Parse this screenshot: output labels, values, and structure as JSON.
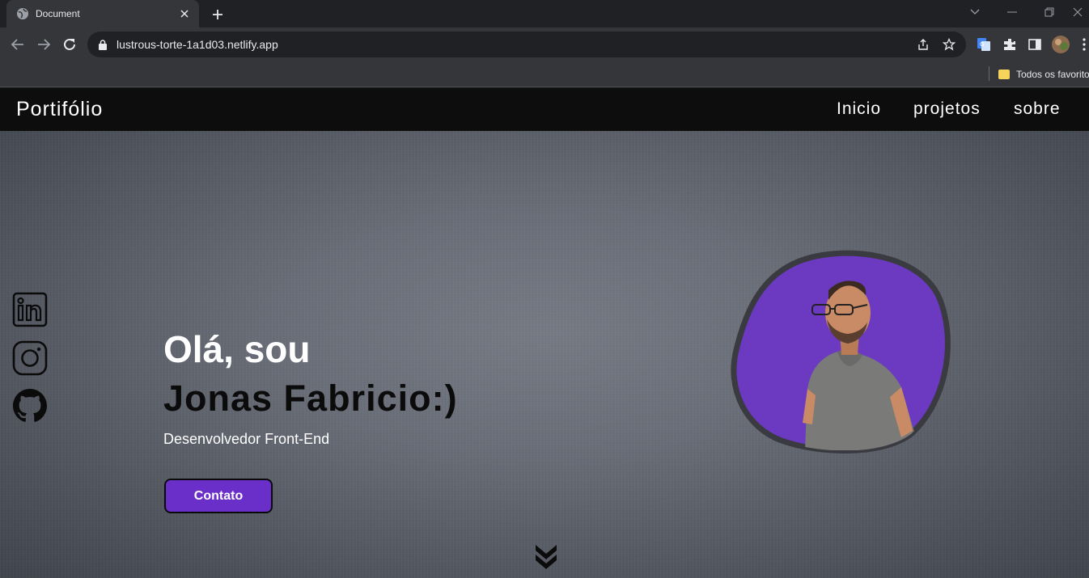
{
  "browser": {
    "tab_title": "Document",
    "url": "lustrous-torte-1a1d03.netlify.app",
    "bookmark_label": "Todos os favoritos"
  },
  "site": {
    "brand": "Portifólio",
    "nav": [
      "Inicio",
      "projetos",
      "sobre"
    ]
  },
  "hero": {
    "greeting_line1": "Olá, sou",
    "greeting_line2": "Jonas Fabricio:)",
    "role": "Desenvolvedor Front-End",
    "contact_button": "Contato"
  },
  "social": [
    "linkedin-icon",
    "instagram-icon",
    "github-icon"
  ],
  "colors": {
    "accent_purple": "#6a2fc9",
    "avatar_purple": "#6b3ac1",
    "header_bg": "#0d0d0d"
  }
}
